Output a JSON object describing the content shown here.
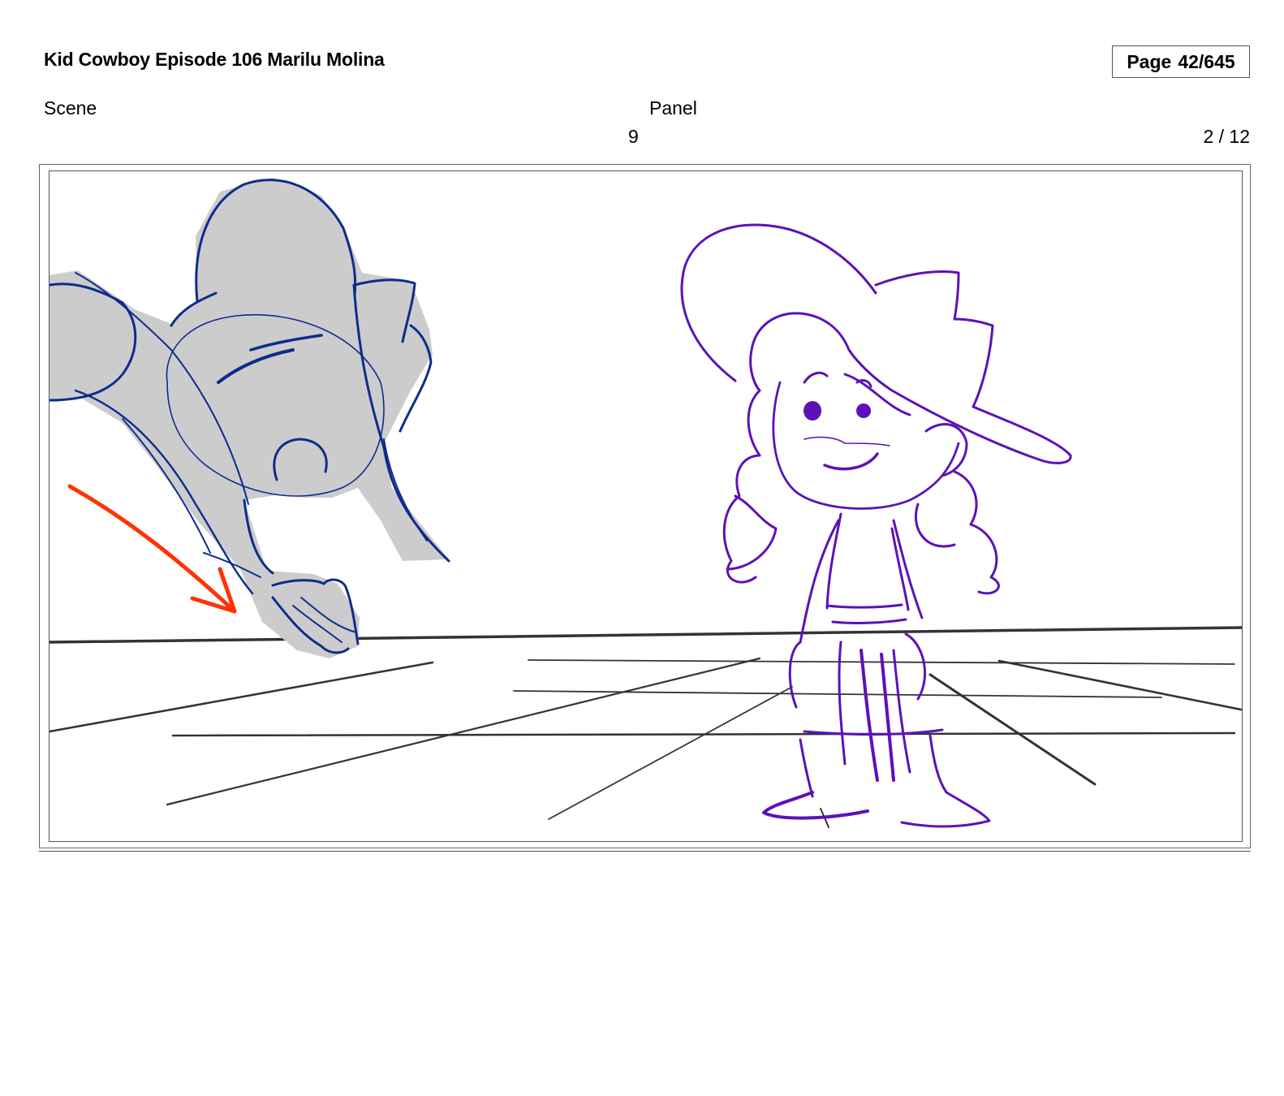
{
  "header": {
    "title": "Kid Cowboy Episode 106 Marilu Molina",
    "page_label": "Page",
    "page_number": "42/645"
  },
  "fields": {
    "scene_label": "Scene",
    "panel_label": "Panel",
    "scene_value": "9",
    "panel_value": "2 / 12"
  },
  "colors": {
    "ink_left_character": "#0d2c8c",
    "ink_right_character": "#5c12b8",
    "action_arrow": "#ff3300",
    "fill_silhouette": "#cccccc",
    "ground_lines": "#333333"
  },
  "illustration": {
    "icon": "storyboard-sketch-icon"
  }
}
